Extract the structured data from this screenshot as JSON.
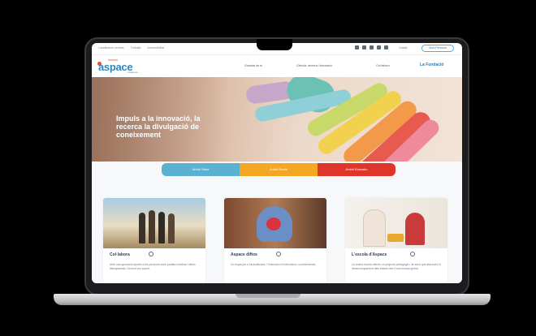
{
  "topbar": {
    "links": [
      "Localització centres",
      "Treballa",
      "Accessibilitat"
    ],
    "lang": "Català",
    "action_button": "Àrea Personal"
  },
  "header": {
    "logo_small": "fundació",
    "logo_big": "aspace",
    "logo_sub": "Catalunya",
    "nav": [
      "Guardar de tu",
      "Ciència, recerca i innovació",
      "Col·labora",
      "La Fundació"
    ]
  },
  "hero": {
    "title": "Impuls a la innovació, la recerca la divulgació de coneixement"
  },
  "tabs": [
    {
      "label": "Àmbit Salut",
      "color": "#5ab1d1"
    },
    {
      "label": "Àmbit Social",
      "color": "#f5a623"
    },
    {
      "label": "Àmbit Educatiu",
      "color": "#e0352b"
    }
  ],
  "cards": [
    {
      "title": "Col·labora",
      "desc": "Amb una aportació ajudes a les persones amb paràlisi cerebral i altres discapacitats. Dóna el teu suport."
    },
    {
      "title": "Aspace diftos",
      "desc": "Un espai per a l'actualització i l'intercanvi d'informació i coneixements."
    },
    {
      "title": "L'escola d'Aspace",
      "desc": "La nostra escola ofereix un projecte pedagògic i de salut que afavoreix el desenvolupament dels infants des d'una mirada global."
    }
  ],
  "colors": {
    "brand": "#2e86c1",
    "accent": "#e6502c"
  }
}
